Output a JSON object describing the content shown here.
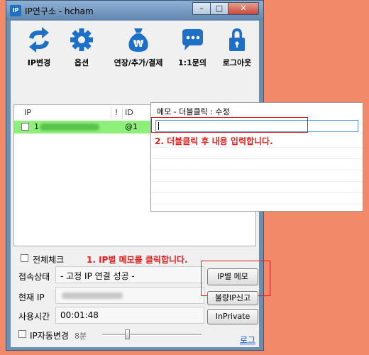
{
  "window": {
    "title": "IP연구소 - hcham",
    "app_icon": "IP",
    "min": "–",
    "max": "□",
    "close": "✕"
  },
  "toolbar": [
    {
      "label": "IP변경",
      "icon": "swap-arrows-icon"
    },
    {
      "label": "옵션",
      "icon": "gear-icon"
    },
    {
      "label": "연장/추가/결제",
      "icon": "money-bag-icon"
    },
    {
      "label": "1:1문의",
      "icon": "chat-bubble-icon"
    },
    {
      "label": "로그아웃",
      "icon": "lock-icon"
    }
  ],
  "list": {
    "headers": {
      "ip": "IP",
      "flag": "!",
      "id": "ID"
    },
    "row": {
      "ip": "1",
      "id": "@1"
    }
  },
  "memo_popup": {
    "header": "메모 - 더블클릭 : 수정",
    "value": ""
  },
  "annotations": {
    "step1": "1. IP별 메모를 클릭합니다.",
    "step2": "2. 더블클릭 후 내용 입력합니다."
  },
  "bottom": {
    "select_all": "전체체크",
    "status_label": "접속상태",
    "status_value": "- 고정 IP 연결 성공 -",
    "current_ip_label": "현재 IP",
    "time_label": "사용시간",
    "time_value": "00:01:48",
    "auto_change": "IP자동변경",
    "auto_interval": "8분",
    "btn_memo": "IP별 메모",
    "btn_report": "불량IP신고",
    "btn_inprivate": "InPrivate",
    "log_link": "로그"
  },
  "colors": {
    "selected_row": "#8ef07a",
    "annotation": "#e02020",
    "icon_blue": "#1e6fc6"
  }
}
